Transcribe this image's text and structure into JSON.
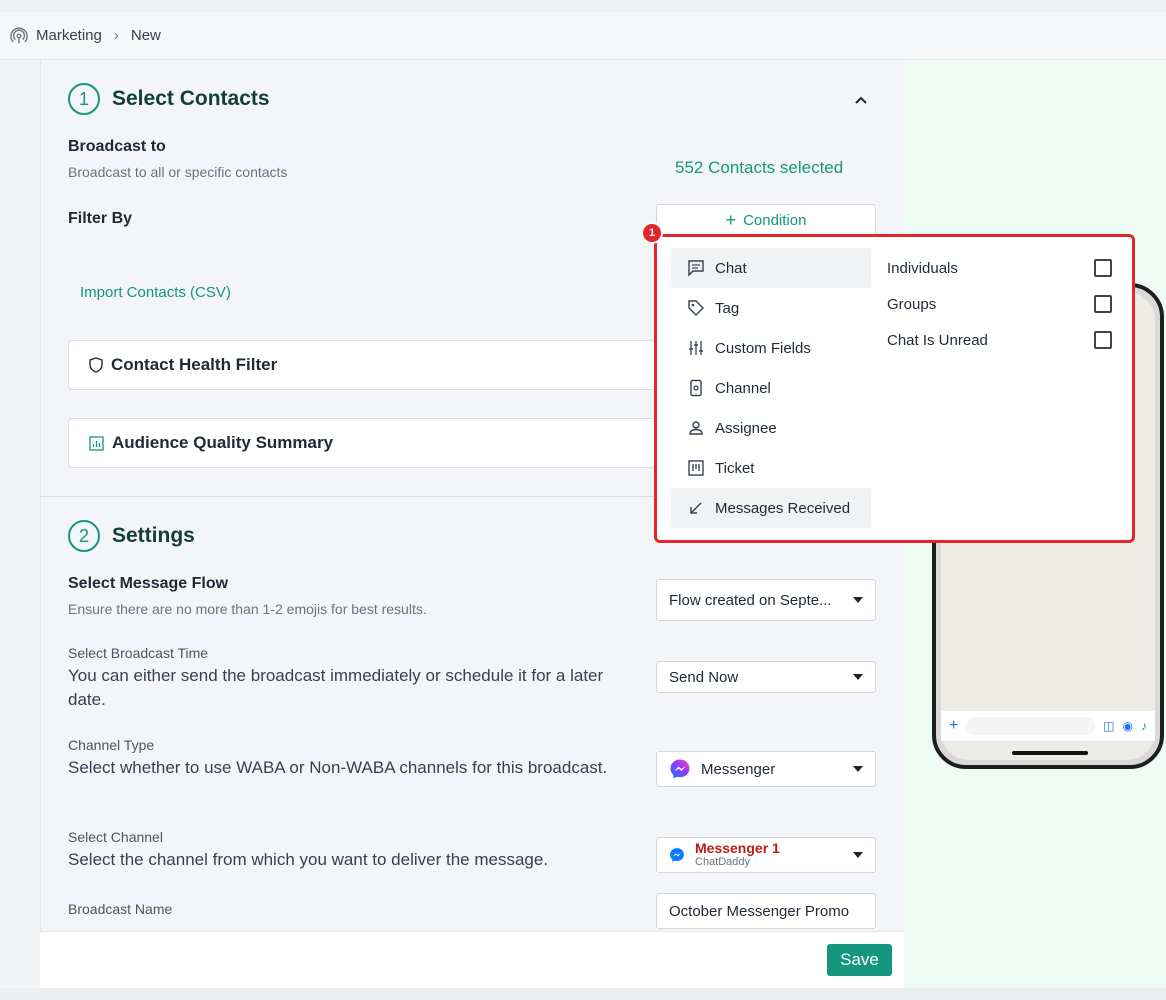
{
  "breadcrumb": {
    "root": "Marketing",
    "current": "New"
  },
  "section1": {
    "number": "1",
    "title": "Select Contacts",
    "broadcast_to_label": "Broadcast to",
    "broadcast_to_desc": "Broadcast to all or specific contacts",
    "contacts_selected": "552 Contacts selected",
    "filter_by_label": "Filter By",
    "condition_button": "Condition",
    "import_link": "Import Contacts (CSV)",
    "health_filter": "Contact Health Filter",
    "audience_summary": "Audience Quality Summary"
  },
  "condition_menu": {
    "badge": "1",
    "categories": [
      {
        "label": "Chat",
        "icon": "chat-icon",
        "active": true
      },
      {
        "label": "Tag",
        "icon": "tag-icon",
        "active": false
      },
      {
        "label": "Custom Fields",
        "icon": "sliders-icon",
        "active": false
      },
      {
        "label": "Channel",
        "icon": "channel-icon",
        "active": false
      },
      {
        "label": "Assignee",
        "icon": "person-icon",
        "active": false
      },
      {
        "label": "Ticket",
        "icon": "ticket-icon",
        "active": false
      },
      {
        "label": "Messages Received",
        "icon": "arrow-down-left-icon",
        "active": true
      }
    ],
    "options": [
      {
        "label": "Individuals",
        "checked": false
      },
      {
        "label": "Groups",
        "checked": false
      },
      {
        "label": "Chat Is Unread",
        "checked": false
      }
    ]
  },
  "section2": {
    "number": "2",
    "title": "Settings",
    "message_flow": {
      "label": "Select Message Flow",
      "desc": "Ensure there are no more than 1-2 emojis for best results.",
      "value": "Flow created on Septe..."
    },
    "broadcast_time": {
      "label": "Select Broadcast Time",
      "desc": "You can either send the broadcast immediately or schedule it for a later date.",
      "value": "Send Now"
    },
    "channel_type": {
      "label": "Channel Type",
      "desc": "Select whether to use WABA or Non-WABA channels for this broadcast.",
      "value": "Messenger"
    },
    "channel": {
      "label": "Select Channel",
      "desc": "Select the channel from which you want to deliver the message.",
      "value": "Messenger 1",
      "sub": "ChatDaddy"
    },
    "broadcast_name": {
      "label": "Broadcast Name",
      "value": "October Messenger Promo"
    }
  },
  "footer": {
    "save": "Save"
  },
  "colors": {
    "accent": "#14967f",
    "highlight": "#e3262b",
    "channel_name": "#b91c1c"
  }
}
